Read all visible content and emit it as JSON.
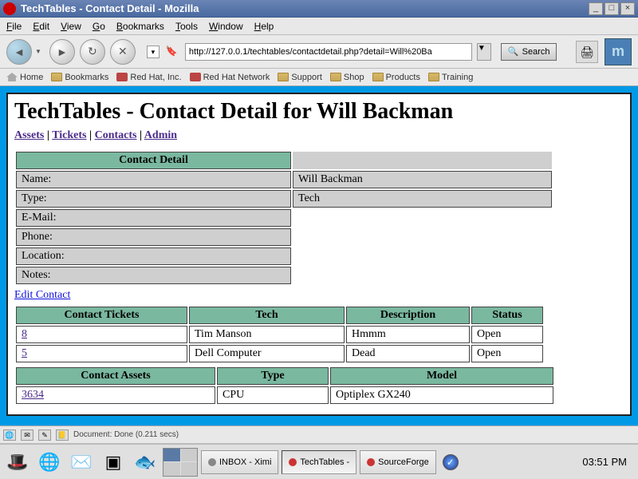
{
  "window": {
    "title": "TechTables - Contact Detail - Mozilla",
    "minimize": "_",
    "maximize": "□",
    "close": "×"
  },
  "menubar": [
    "File",
    "Edit",
    "View",
    "Go",
    "Bookmarks",
    "Tools",
    "Window",
    "Help"
  ],
  "toolbar": {
    "back": "◄",
    "forward": "►",
    "reload": "↻",
    "stop": "✕",
    "url": "http://127.0.0.1/techtables/contactdetail.php?detail=Will%20Ba",
    "search_label": "Search",
    "print": "🖨"
  },
  "bookmarkbar": [
    {
      "icon": "home",
      "label": "Home"
    },
    {
      "icon": "folder",
      "label": "Bookmarks"
    },
    {
      "icon": "link",
      "label": "Red Hat, Inc."
    },
    {
      "icon": "link",
      "label": "Red Hat Network"
    },
    {
      "icon": "folder",
      "label": "Support"
    },
    {
      "icon": "folder",
      "label": "Shop"
    },
    {
      "icon": "folder",
      "label": "Products"
    },
    {
      "icon": "folder",
      "label": "Training"
    }
  ],
  "page": {
    "heading": "TechTables - Contact Detail for Will Backman",
    "nav": [
      "Assets",
      "Tickets",
      "Contacts",
      "Admin"
    ],
    "sep": " | ",
    "detail_header": "Contact Detail",
    "detail_rows": [
      {
        "label": "Name:",
        "value": "Will Backman"
      },
      {
        "label": "Type:",
        "value": "Tech"
      },
      {
        "label": "E-Mail:",
        "value": ""
      },
      {
        "label": "Phone:",
        "value": ""
      },
      {
        "label": "Location:",
        "value": ""
      },
      {
        "label": "Notes:",
        "value": ""
      }
    ],
    "edit_link": "Edit Contact",
    "tickets_headers": [
      "Contact Tickets",
      "Tech",
      "Description",
      "Status"
    ],
    "tickets": [
      {
        "id": "8",
        "tech": "Tim Manson",
        "desc": "Hmmm",
        "status": "Open"
      },
      {
        "id": "5",
        "tech": "Dell Computer",
        "desc": "Dead",
        "status": "Open"
      }
    ],
    "assets_headers": [
      "Contact Assets",
      "Type",
      "Model"
    ],
    "assets": [
      {
        "id": "3634",
        "type": "CPU",
        "model": "Optiplex GX240"
      }
    ]
  },
  "statusbar": {
    "text": "Document: Done (0.211 secs)"
  },
  "taskbar": {
    "tasks": [
      {
        "label": "INBOX - Ximi",
        "klass": ""
      },
      {
        "label": "TechTables -",
        "klass": "active"
      },
      {
        "label": "SourceForge",
        "klass": ""
      }
    ],
    "clock": "03:51 PM"
  }
}
